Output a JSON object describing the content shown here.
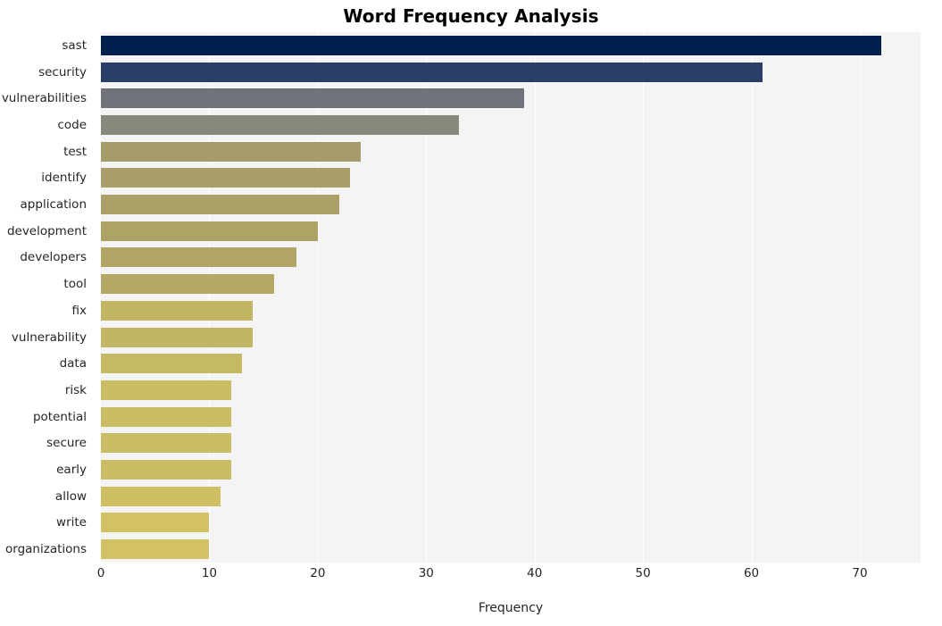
{
  "chart_data": {
    "type": "bar",
    "orientation": "horizontal",
    "title": "Word Frequency Analysis",
    "xlabel": "Frequency",
    "ylabel": "",
    "xlim": [
      0,
      75.6
    ],
    "xticks": [
      0,
      10,
      20,
      30,
      40,
      50,
      60,
      70
    ],
    "xticklabels": [
      "0",
      "10",
      "20",
      "30",
      "40",
      "50",
      "60",
      "70"
    ],
    "grid": "vertical-white",
    "legend": "none",
    "categories": [
      "sast",
      "security",
      "vulnerabilities",
      "code",
      "test",
      "identify",
      "application",
      "development",
      "developers",
      "tool",
      "fix",
      "vulnerability",
      "data",
      "risk",
      "potential",
      "secure",
      "early",
      "allow",
      "write",
      "organizations"
    ],
    "values": [
      72,
      61,
      39,
      33,
      24,
      23,
      22,
      20,
      18,
      16,
      14,
      14,
      13,
      12,
      12,
      12,
      12,
      11,
      10,
      10
    ],
    "bar_colors": [
      "#00204d",
      "#2a3f68",
      "#70727a",
      "#88887c",
      "#a69b6b",
      "#a99e6a",
      "#aba068",
      "#aea367",
      "#b1a665",
      "#b4a964",
      "#c2b563",
      "#c2b563",
      "#c6b963",
      "#cabd63",
      "#cabd63",
      "#cabd63",
      "#cabd63",
      "#cebf63",
      "#d3c263",
      "#d3c263"
    ],
    "plot_background": "#f4f4f5",
    "figure_background": "#ffffff",
    "text_color": "#262626"
  }
}
